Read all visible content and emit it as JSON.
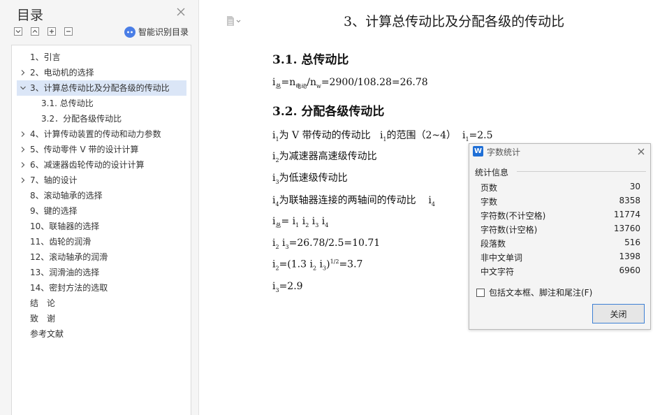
{
  "sidebar": {
    "title": "目录",
    "smart_toc_label": "智能识别目录",
    "items": [
      {
        "label": "1、引言",
        "arrow": "none"
      },
      {
        "label": "2、电动机的选择",
        "arrow": "right"
      },
      {
        "label": "3、计算总传动比及分配各级的传动比",
        "arrow": "down",
        "active": true
      },
      {
        "label": "3.1. 总传动比",
        "arrow": "none"
      },
      {
        "label": "3.2．分配各级传动比",
        "arrow": "none"
      },
      {
        "label": "4、计算传动装置的传动和动力参数",
        "arrow": "right"
      },
      {
        "label": "5、传动零件 V 带的设计计算",
        "arrow": "right"
      },
      {
        "label": "6、减速器齿轮传动的设计计算",
        "arrow": "right"
      },
      {
        "label": "7、轴的设计",
        "arrow": "right"
      },
      {
        "label": "8、滚动轴承的选择",
        "arrow": "none"
      },
      {
        "label": "9、键的选择",
        "arrow": "none"
      },
      {
        "label": "10、联轴器的选择",
        "arrow": "none"
      },
      {
        "label": "11、齿轮的润滑",
        "arrow": "none"
      },
      {
        "label": "12、滚动轴承的润滑",
        "arrow": "none"
      },
      {
        "label": "13、润滑油的选择",
        "arrow": "none"
      },
      {
        "label": "14、密封方法的选取",
        "arrow": "none"
      },
      {
        "label": "结　论",
        "arrow": "none"
      },
      {
        "label": "致　谢",
        "arrow": "none"
      },
      {
        "label": "参考文献",
        "arrow": "none"
      }
    ]
  },
  "document": {
    "title": "3、计算总传动比及分配各级的传动比",
    "h1": "3.1. 总传动比",
    "total_ratio": {
      "sym": "i",
      "sub1": "总",
      "mid": "=n",
      "sub2": "电动",
      "div": "/n",
      "sub3": "w",
      "rest": "=2900/108.28=26.78"
    },
    "h2": "3.2. 分配各级传动比",
    "line_i1": {
      "a": "为 V 带传动的传动比",
      "b": "的范围（2~4）",
      "c": "=2.5"
    },
    "line_i2": "为减速器高速级传动比",
    "line_i3": "为低速级传动比",
    "line_i4": "为联轴器连接的两轴间的传动比",
    "line_prod": "= i",
    "line_i2i3": "=26.78/2.5=10.71",
    "line_i2val": {
      "a": "=(1.3 i",
      "b": " i",
      "c": ")",
      "exp": "1/2",
      "d": "=3.7"
    },
    "line_i3val": "=2.9"
  },
  "dialog": {
    "title": "字数统计",
    "icon_letter": "W",
    "section": "统计信息",
    "stats": [
      {
        "label": "页数",
        "value": "30"
      },
      {
        "label": "字数",
        "value": "8358"
      },
      {
        "label": "字符数(不计空格)",
        "value": "11774"
      },
      {
        "label": "字符数(计空格)",
        "value": "13760"
      },
      {
        "label": "段落数",
        "value": "516"
      },
      {
        "label": "非中文单词",
        "value": "1398"
      },
      {
        "label": "中文字符",
        "value": "6960"
      }
    ],
    "checkbox_label": "包括文本框、脚注和尾注(F)",
    "checkbox_checked": false,
    "close_label": "关闭"
  },
  "colors": {
    "accent": "#1f6fd6",
    "active_item": "#dbe6f7",
    "dialog_button_border": "#3c7fd4"
  }
}
